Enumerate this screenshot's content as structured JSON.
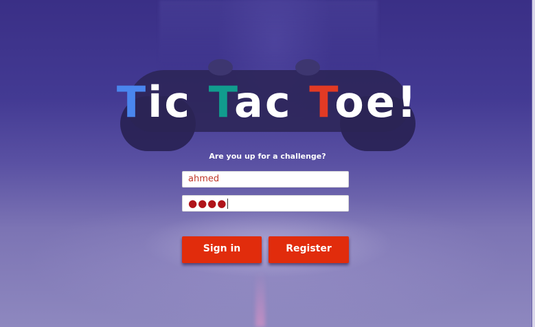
{
  "title": {
    "letters": [
      "T",
      "ic ",
      "T",
      "ac ",
      "T",
      "oe!"
    ]
  },
  "subtitle": "Are you up for a challenge?",
  "login_form": {
    "username_value": "ahmed",
    "password_masked": "●●●●"
  },
  "buttons": {
    "sign_in": "Sign in",
    "register": "Register"
  },
  "colors": {
    "title_blue": "#4a86ee",
    "title_teal": "#119c8e",
    "title_red": "#e23a24",
    "button_red": "#e12c0c"
  }
}
